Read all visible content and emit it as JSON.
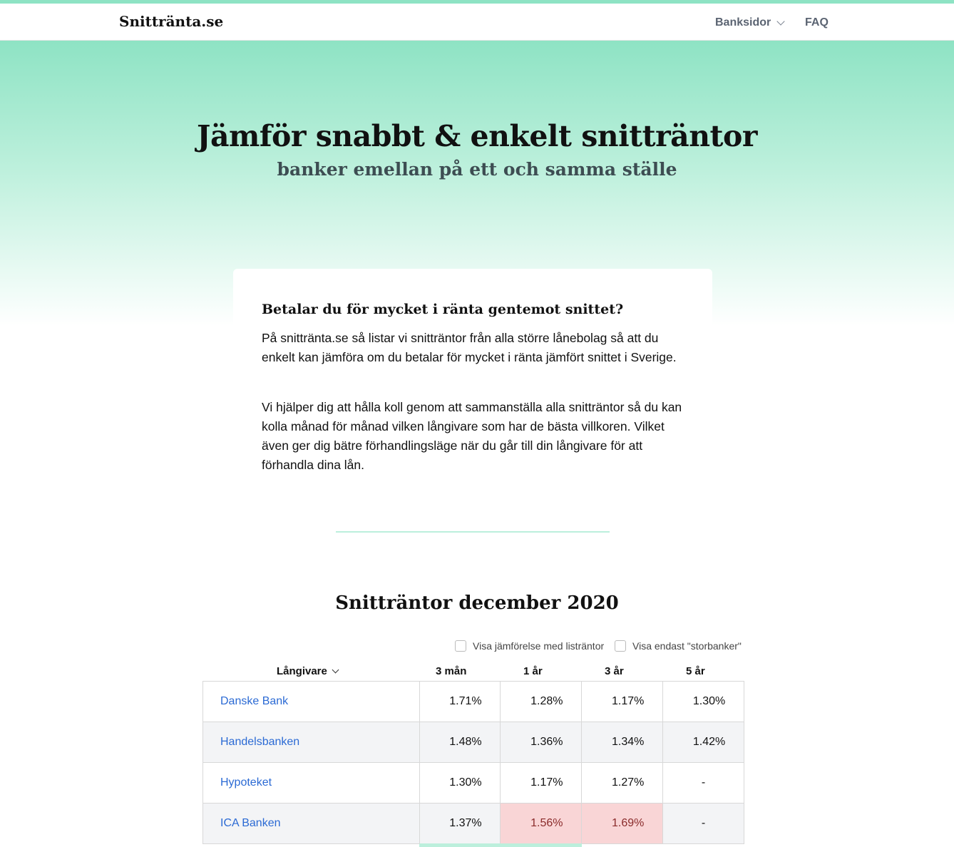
{
  "nav": {
    "brand": "Snittränta.se",
    "items": [
      {
        "label": "Banksidor",
        "has_dropdown": true
      },
      {
        "label": "FAQ",
        "has_dropdown": false
      }
    ]
  },
  "hero": {
    "title": "Jämför snabbt & enkelt snitträntor",
    "subtitle": "banker emellan på ett och samma ställe"
  },
  "intro": {
    "heading": "Betalar du för mycket i ränta gentemot snittet?",
    "paragraph1": "På snittränta.se så listar vi snitträntor från alla större lånebolag så att du enkelt kan jämföra om du betalar för mycket i ränta jämfört snittet i Sverige.",
    "paragraph2": "Vi hjälper dig att hålla koll genom att sammanställa alla snitträntor så du kan kolla månad för månad vilken långivare som har de bästa villkoren. Vilket även ger dig bätre förhandlingsläge när du går till din långivare för att förhandla dina lån."
  },
  "rates": {
    "title": "Snitträntor december 2020",
    "filters": [
      {
        "label": "Visa jämförelse med listräntor",
        "checked": false
      },
      {
        "label": "Visa endast \"storbanker\"",
        "checked": false
      }
    ],
    "columns": [
      "Långivare",
      "3 mån",
      "1 år",
      "3 år",
      "5 år"
    ],
    "rows": [
      {
        "lender": "Danske Bank",
        "values": [
          "1.71%",
          "1.28%",
          "1.17%",
          "1.30%"
        ],
        "highlight": [
          false,
          false,
          false,
          false
        ]
      },
      {
        "lender": "Handelsbanken",
        "values": [
          "1.48%",
          "1.36%",
          "1.34%",
          "1.42%"
        ],
        "highlight": [
          false,
          false,
          false,
          false
        ]
      },
      {
        "lender": "Hypoteket",
        "values": [
          "1.30%",
          "1.17%",
          "1.27%",
          "-"
        ],
        "highlight": [
          false,
          false,
          false,
          false
        ]
      },
      {
        "lender": "ICA Banken",
        "values": [
          "1.37%",
          "1.56%",
          "1.69%",
          "-"
        ],
        "highlight": [
          false,
          true,
          true,
          false
        ]
      }
    ],
    "colors": {
      "link": "#2b6ad4",
      "highlight_bg": "#f9d5d6",
      "highlight_text": "#8a2b2b",
      "alt_row": "#f3f4f6",
      "accent": "#8ee3c4"
    }
  }
}
